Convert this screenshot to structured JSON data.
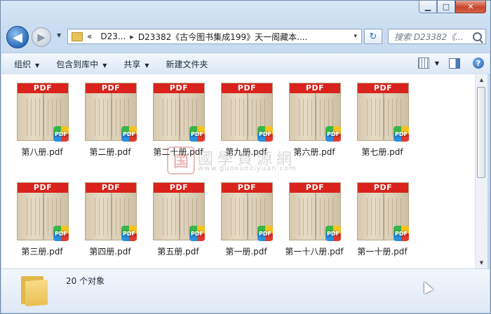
{
  "window": {
    "caption": {
      "minimize": "▁",
      "maximize": "□",
      "close": "✕"
    }
  },
  "nav": {
    "back_icon": "◀",
    "forward_icon": "▶",
    "dropdown_icon": "▼"
  },
  "address": {
    "overflow": "«",
    "segments": [
      "D23...",
      "D23382《古今图书集成199》天一阁藏本...."
    ],
    "separator": "▸",
    "dropdown": "▾"
  },
  "search": {
    "placeholder": "搜索 D23382《..."
  },
  "toolbar": {
    "organize": "组织",
    "include_in_library": "包含到库中",
    "share": "共享",
    "new_folder": "新建文件夹"
  },
  "files": [
    {
      "name": "第八册.pdf",
      "type_band": "PDF",
      "badge": "PDF"
    },
    {
      "name": "第二册.pdf",
      "type_band": "PDF",
      "badge": "PDF"
    },
    {
      "name": "第二十册.pdf",
      "type_band": "PDF",
      "badge": "PDF"
    },
    {
      "name": "第九册.pdf",
      "type_band": "PDF",
      "badge": "PDF"
    },
    {
      "name": "第六册.pdf",
      "type_band": "PDF",
      "badge": "PDF"
    },
    {
      "name": "第七册.pdf",
      "type_band": "PDF",
      "badge": "PDF"
    },
    {
      "name": "第三册.pdf",
      "type_band": "PDF",
      "badge": "PDF"
    },
    {
      "name": "第四册.pdf",
      "type_band": "PDF",
      "badge": "PDF"
    },
    {
      "name": "第五册.pdf",
      "type_band": "PDF",
      "badge": "PDF"
    },
    {
      "name": "第一册.pdf",
      "type_band": "PDF",
      "badge": "PDF"
    },
    {
      "name": "第一十八册.pdf",
      "type_band": "PDF",
      "badge": "PDF"
    },
    {
      "name": "第一十册.pdf",
      "type_band": "PDF",
      "badge": "PDF"
    }
  ],
  "watermark": {
    "logo": "国",
    "text_cn": "國學資源網",
    "url": "www.guoxueziyuan.com"
  },
  "status": {
    "count": "20 个对象"
  },
  "colors": {
    "pdf_band": "#d9231c",
    "window_bg": "#c9dcf1"
  }
}
